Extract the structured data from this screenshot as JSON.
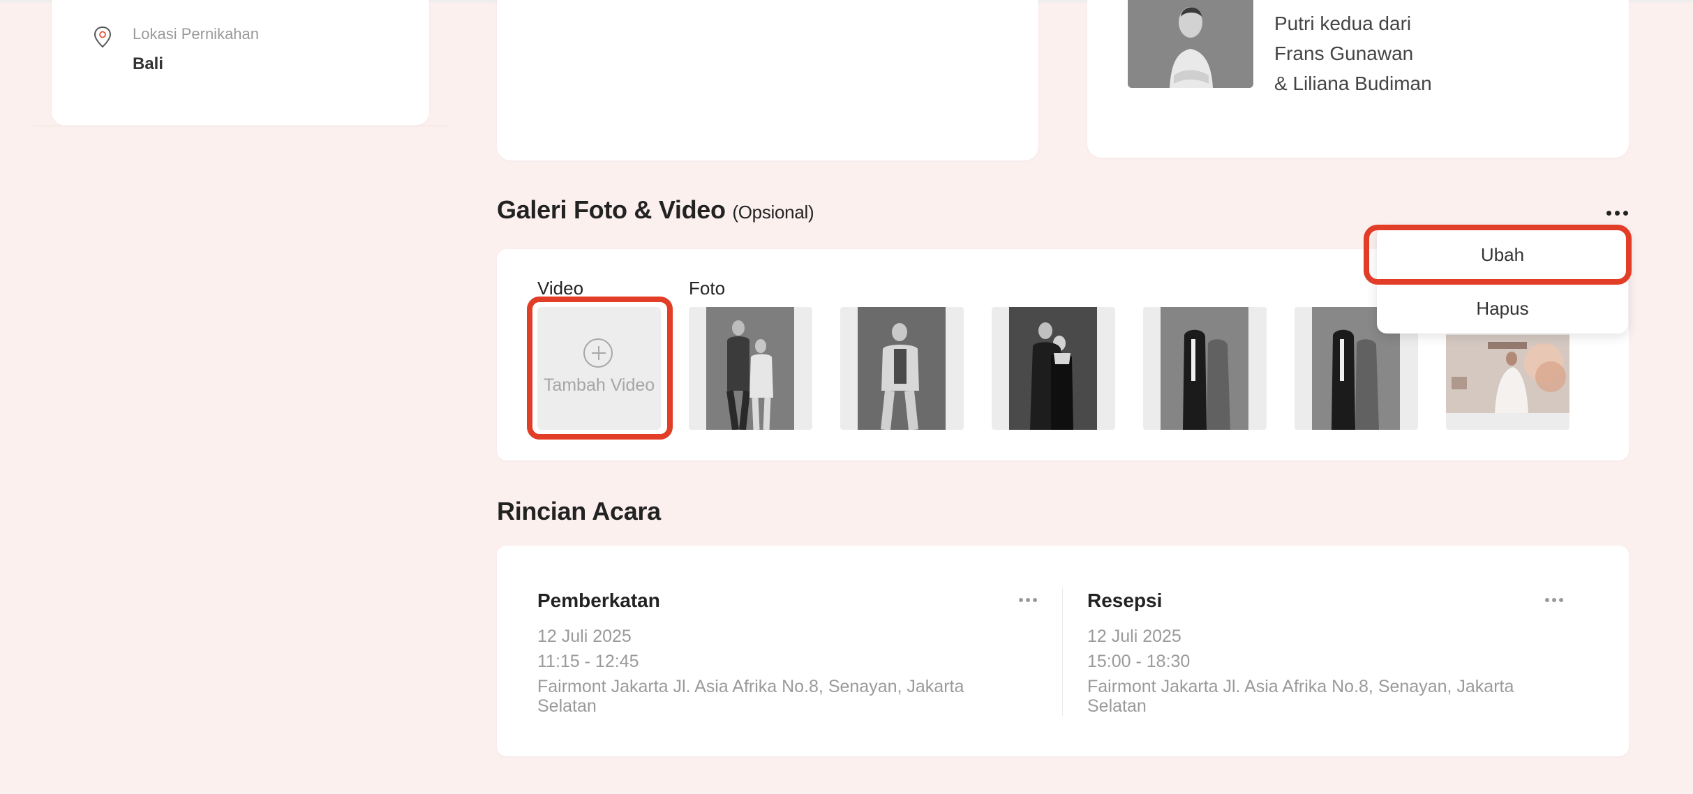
{
  "profile": {
    "location_label": "Lokasi Pernikahan",
    "location_value": "Bali",
    "parents_lines": [
      "Putri kedua dari",
      "Frans Gunawan",
      "& Liliana Budiman"
    ]
  },
  "gallery": {
    "title": "Galeri Foto & Video",
    "optional": "(Opsional)",
    "video_label": "Video",
    "foto_label": "Foto",
    "add_video_label": "Tambah Video",
    "photo_count": 6
  },
  "menu": {
    "edit_label": "Ubah",
    "delete_label": "Hapus"
  },
  "events": {
    "title": "Rincian Acara",
    "items": [
      {
        "name": "Pemberkatan",
        "date": "12 Juli 2025",
        "time": "11:15 - 12:45",
        "address_line1": "Fairmont Jakarta Jl. Asia Afrika No.8, Senayan, Jakarta",
        "address_line2": "Selatan"
      },
      {
        "name": "Resepsi",
        "date": "12 Juli 2025",
        "time": "15:00 - 18:30",
        "address_line1": "Fairmont Jakarta Jl. Asia Afrika No.8, Senayan, Jakarta",
        "address_line2": "Selatan"
      }
    ]
  },
  "colors": {
    "page_bg": "#fcf0ef",
    "highlight": "#e23d26",
    "muted_text": "#9a9a9a"
  }
}
